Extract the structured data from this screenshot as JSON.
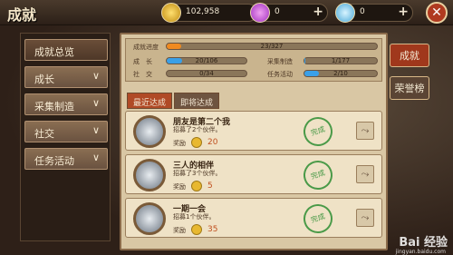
{
  "header": {
    "title": "成就",
    "resources": [
      {
        "icon": "gold-coin-icon",
        "value": "102,958"
      },
      {
        "icon": "purple-gem-icon",
        "value": "0"
      },
      {
        "icon": "diamond-icon",
        "value": "0"
      }
    ],
    "close_icon": "close-icon"
  },
  "sidebar": {
    "items": [
      {
        "label": "成就总览",
        "chevron": ""
      },
      {
        "label": "成长",
        "chevron": "∨"
      },
      {
        "label": "采集制造",
        "chevron": "∨"
      },
      {
        "label": "社交",
        "chevron": "∨"
      },
      {
        "label": "任务活动",
        "chevron": "∨"
      }
    ]
  },
  "stats": {
    "progress_label": "成就进度",
    "progress_text": "23/327",
    "progress_fraction": 0.07,
    "growth_label": "成　长",
    "growth_text": "20/106",
    "growth_fraction": 0.19,
    "social_label": "社　交",
    "social_text": "0/34",
    "social_fraction": 0,
    "gather_label": "采集制造",
    "gather_text": "1/177",
    "gather_fraction": 0.01,
    "task_label": "任务活动",
    "task_text": "2/10",
    "task_fraction": 0.2
  },
  "tabs": {
    "recent": "最近达成",
    "upcoming": "即将达成"
  },
  "achievements": [
    {
      "name": "朋友是第二个我",
      "desc": "招募了2个伙伴。",
      "reward_label": "奖励",
      "amount": "20",
      "stamp": "完成"
    },
    {
      "name": "三人的相伴",
      "desc": "招募了3个伙伴。",
      "reward_label": "奖励",
      "amount": "5",
      "stamp": "完成"
    },
    {
      "name": "一期一会",
      "desc": "招募1个伙伴。",
      "reward_label": "奖励",
      "amount": "35",
      "stamp": "完成"
    }
  ],
  "right_tabs": {
    "achievement": "成就",
    "honor": "荣誉榜"
  },
  "watermark": {
    "text": "Bai 经验",
    "sub": "jingyan.baidu.com"
  },
  "colors": {
    "bar_orange": "#f08a20",
    "bar_blue": "#3aa0e8",
    "accent_red": "#a0381c"
  }
}
